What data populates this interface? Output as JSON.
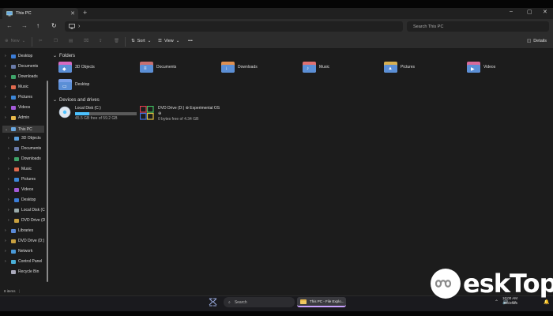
{
  "window": {
    "tab_title": "This PC",
    "minimize": "–",
    "maximize": "▢",
    "close": "✕",
    "new_tab": "+"
  },
  "address": {
    "path_arrow": "›",
    "search_placeholder": "Search This PC"
  },
  "toolbar": {
    "new_label": "New",
    "sort_label": "Sort",
    "view_label": "View",
    "more_label": "•••",
    "details_label": "Details"
  },
  "sidebar": {
    "items": [
      {
        "label": "Desktop",
        "icon": "desktop-icon",
        "color": "#3b7dd8"
      },
      {
        "label": "Documents",
        "icon": "documents-icon",
        "color": "#6a7ba8"
      },
      {
        "label": "Downloads",
        "icon": "downloads-icon",
        "color": "#3fa46a"
      },
      {
        "label": "Music",
        "icon": "music-icon",
        "color": "#e06a4e"
      },
      {
        "label": "Pictures",
        "icon": "pictures-icon",
        "color": "#3b86d8"
      },
      {
        "label": "Videos",
        "icon": "videos-icon",
        "color": "#a45ad8"
      },
      {
        "label": "Admin",
        "icon": "user-folder-icon",
        "color": "#e8b84a"
      },
      {
        "label": "This PC",
        "icon": "computer-icon",
        "color": "#6aa8e0"
      },
      {
        "label": "3D Objects",
        "icon": "3d-objects-icon",
        "color": "#5aa0e0"
      },
      {
        "label": "Documents",
        "icon": "documents-icon",
        "color": "#6a7ba8"
      },
      {
        "label": "Downloads",
        "icon": "downloads-icon",
        "color": "#3fa46a"
      },
      {
        "label": "Music",
        "icon": "music-icon",
        "color": "#e06a4e"
      },
      {
        "label": "Pictures",
        "icon": "pictures-icon",
        "color": "#3b86d8"
      },
      {
        "label": "Videos",
        "icon": "videos-icon",
        "color": "#a45ad8"
      },
      {
        "label": "Desktop",
        "icon": "desktop-icon",
        "color": "#3b7dd8"
      },
      {
        "label": "Local Disk (C",
        "icon": "drive-icon",
        "color": "#9aa"
      },
      {
        "label": "DVD Drive (D",
        "icon": "dvd-icon",
        "color": "#c8a040"
      },
      {
        "label": "Libraries",
        "icon": "libraries-icon",
        "color": "#5a8ad8"
      },
      {
        "label": "DVD Drive (D:)",
        "icon": "dvd-icon",
        "color": "#c8a040"
      },
      {
        "label": "Network",
        "icon": "network-icon",
        "color": "#4a9ad8"
      },
      {
        "label": "Control Panel",
        "icon": "control-panel-icon",
        "color": "#4ab0d8"
      },
      {
        "label": "Recycle Bin",
        "icon": "recycle-bin-icon",
        "color": "#aab"
      }
    ]
  },
  "main": {
    "folders_heading": "Folders",
    "folders": [
      {
        "label": "3D Objects",
        "icon": "3d-objects-folder-icon",
        "accent": "#d86ac0"
      },
      {
        "label": "Documents",
        "icon": "documents-folder-icon",
        "accent": "#c87070"
      },
      {
        "label": "Downloads",
        "icon": "downloads-folder-icon",
        "accent": "#e09050"
      },
      {
        "label": "Music",
        "icon": "music-folder-icon",
        "accent": "#e07070"
      },
      {
        "label": "Pictures",
        "icon": "pictures-folder-icon",
        "accent": "#d8b050"
      },
      {
        "label": "Videos",
        "icon": "videos-folder-icon",
        "accent": "#d86a9a"
      },
      {
        "label": "Desktop",
        "icon": "desktop-folder-icon",
        "accent": "#7aa0e8"
      }
    ],
    "drives_heading": "Devices and drives",
    "drives": [
      {
        "label": "Local Disk (C:)",
        "meta": "45.5 GB free of 59.2 GB",
        "used_fraction": 0.23
      },
      {
        "label": "DVD Drive (D:) ⊕ Experimental OS",
        "label2": "⊕",
        "meta": "0 bytes free of 4.34 GB"
      }
    ]
  },
  "status": {
    "items_count": "8 items"
  },
  "taskbar": {
    "search_label": "Search",
    "app_label": "This PC - File Explo...",
    "time": "10:00 AM",
    "date": "3/8/2025"
  },
  "watermark": {
    "text": "eskTop"
  },
  "colors": {
    "accent": "#4cc2ff",
    "selection": "#3a3a3a"
  }
}
